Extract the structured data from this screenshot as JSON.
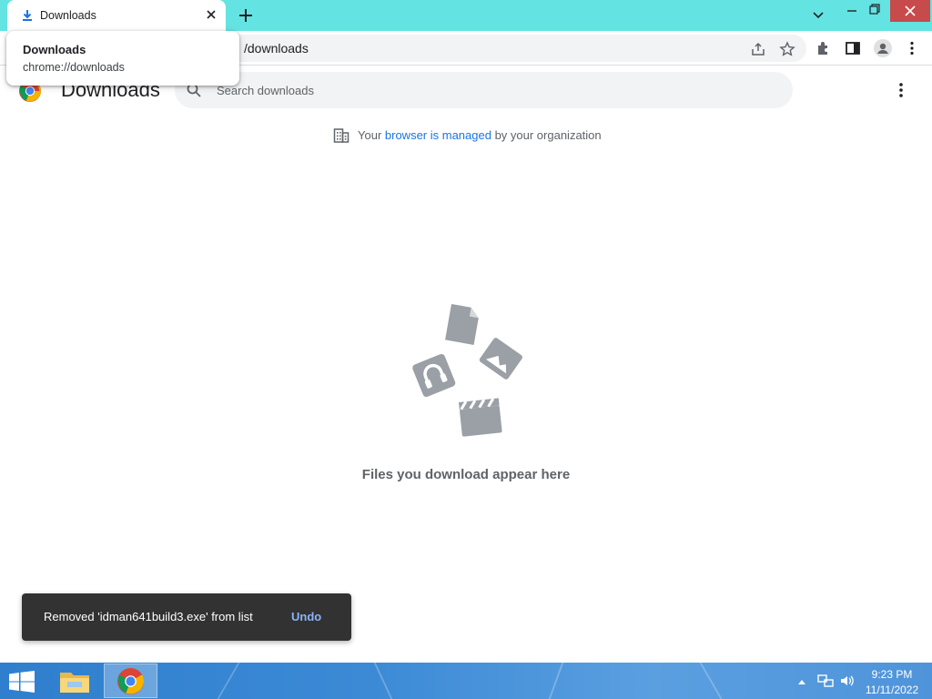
{
  "tab": {
    "title": "Downloads"
  },
  "hovercard": {
    "title": "Downloads",
    "url": "chrome://downloads"
  },
  "omnibox": {
    "visible_text": "/downloads"
  },
  "page": {
    "title": "Downloads",
    "search_placeholder": "Search downloads",
    "managed_prefix": "Your ",
    "managed_link": "browser is managed",
    "managed_suffix": " by your organization",
    "empty_text": "Files you download appear here"
  },
  "toast": {
    "message": "Removed 'idman641build3.exe' from list",
    "undo_label": "Undo"
  },
  "taskbar": {
    "time": "9:23 PM",
    "date": "11/11/2022"
  },
  "colors": {
    "tabstrip": "#64e3e3",
    "accent_link": "#1a73e8",
    "toast_bg": "#323232",
    "toast_action": "#8ab4f8"
  },
  "icons": [
    "download-icon",
    "close-icon",
    "plus-icon",
    "chevron-down-icon",
    "minimize-icon",
    "maximize-icon",
    "window-close-icon",
    "share-icon",
    "star-icon",
    "extensions-icon",
    "side-panel-icon",
    "profile-icon",
    "more-vert-icon",
    "search-icon",
    "building-icon",
    "chrome-logo-icon",
    "windows-start-icon",
    "file-explorer-icon"
  ]
}
